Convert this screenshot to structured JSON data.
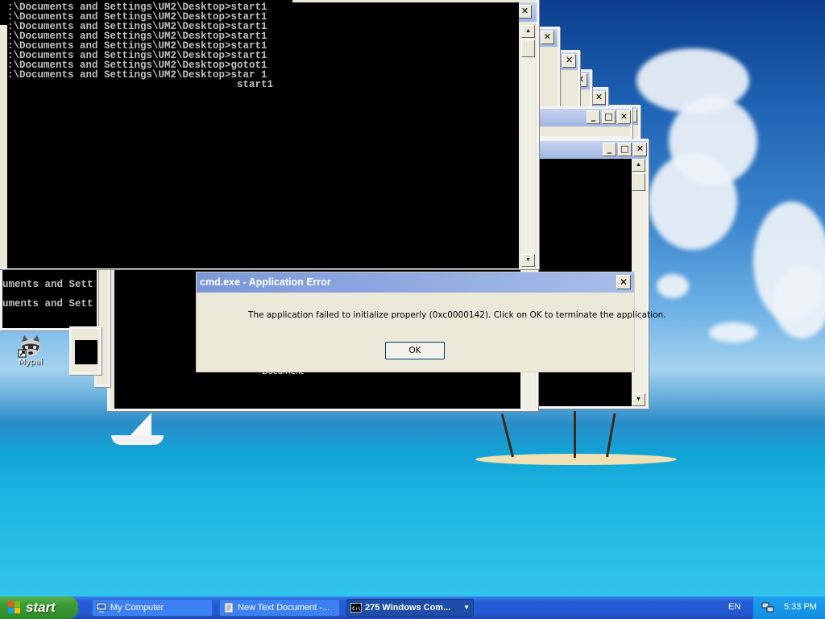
{
  "console": {
    "lines": [
      ":\\Documents and Settings\\UM2\\Desktop>start1",
      ":\\Documents and Settings\\UM2\\Desktop>start1",
      ":\\Documents and Settings\\UM2\\Desktop>start1",
      ":\\Documents and Settings\\UM2\\Desktop>start1",
      ":\\Documents and Settings\\UM2\\Desktop>start1",
      ":\\Documents and Settings\\UM2\\Desktop>start1",
      ":\\Documents and Settings\\UM2\\Desktop>gotot1",
      ":\\Documents and Settings\\UM2\\Desktop>star 1",
      "                                      start1"
    ],
    "fragment_lines": [
      "uments and Sett",
      "uments and Sett"
    ]
  },
  "dialog": {
    "title": "cmd.exe - Application Error",
    "message": "The application failed to initialize properly (0xc0000142). Click on OK to terminate the application.",
    "ok_label": "OK",
    "close_glyph": "✕"
  },
  "window_controls": {
    "minimize": "_",
    "maximize": "□",
    "close": "✕"
  },
  "scroll_glyphs": {
    "up": "▲",
    "down": "▼"
  },
  "desktop_icons": [
    {
      "label": "Mypal",
      "icon": "raccoon-icon"
    },
    {
      "label": "New Text Document",
      "icon": "text-document-icon"
    }
  ],
  "taskbar": {
    "start_label": "start",
    "tasks": [
      {
        "label": "My Computer",
        "icon": "my-computer-icon",
        "active": false
      },
      {
        "label": "New Text Document -...",
        "icon": "notepad-icon",
        "active": false
      },
      {
        "label": "275 Windows Com...",
        "icon": "cmd-icon",
        "active": true
      }
    ],
    "language": "EN",
    "clock": "5:33 PM"
  },
  "colors": {
    "taskbar_blue": "#2457d2",
    "start_green": "#3c9a34",
    "dialog_title": "#7b97d8",
    "window_face": "#ece9d8"
  }
}
